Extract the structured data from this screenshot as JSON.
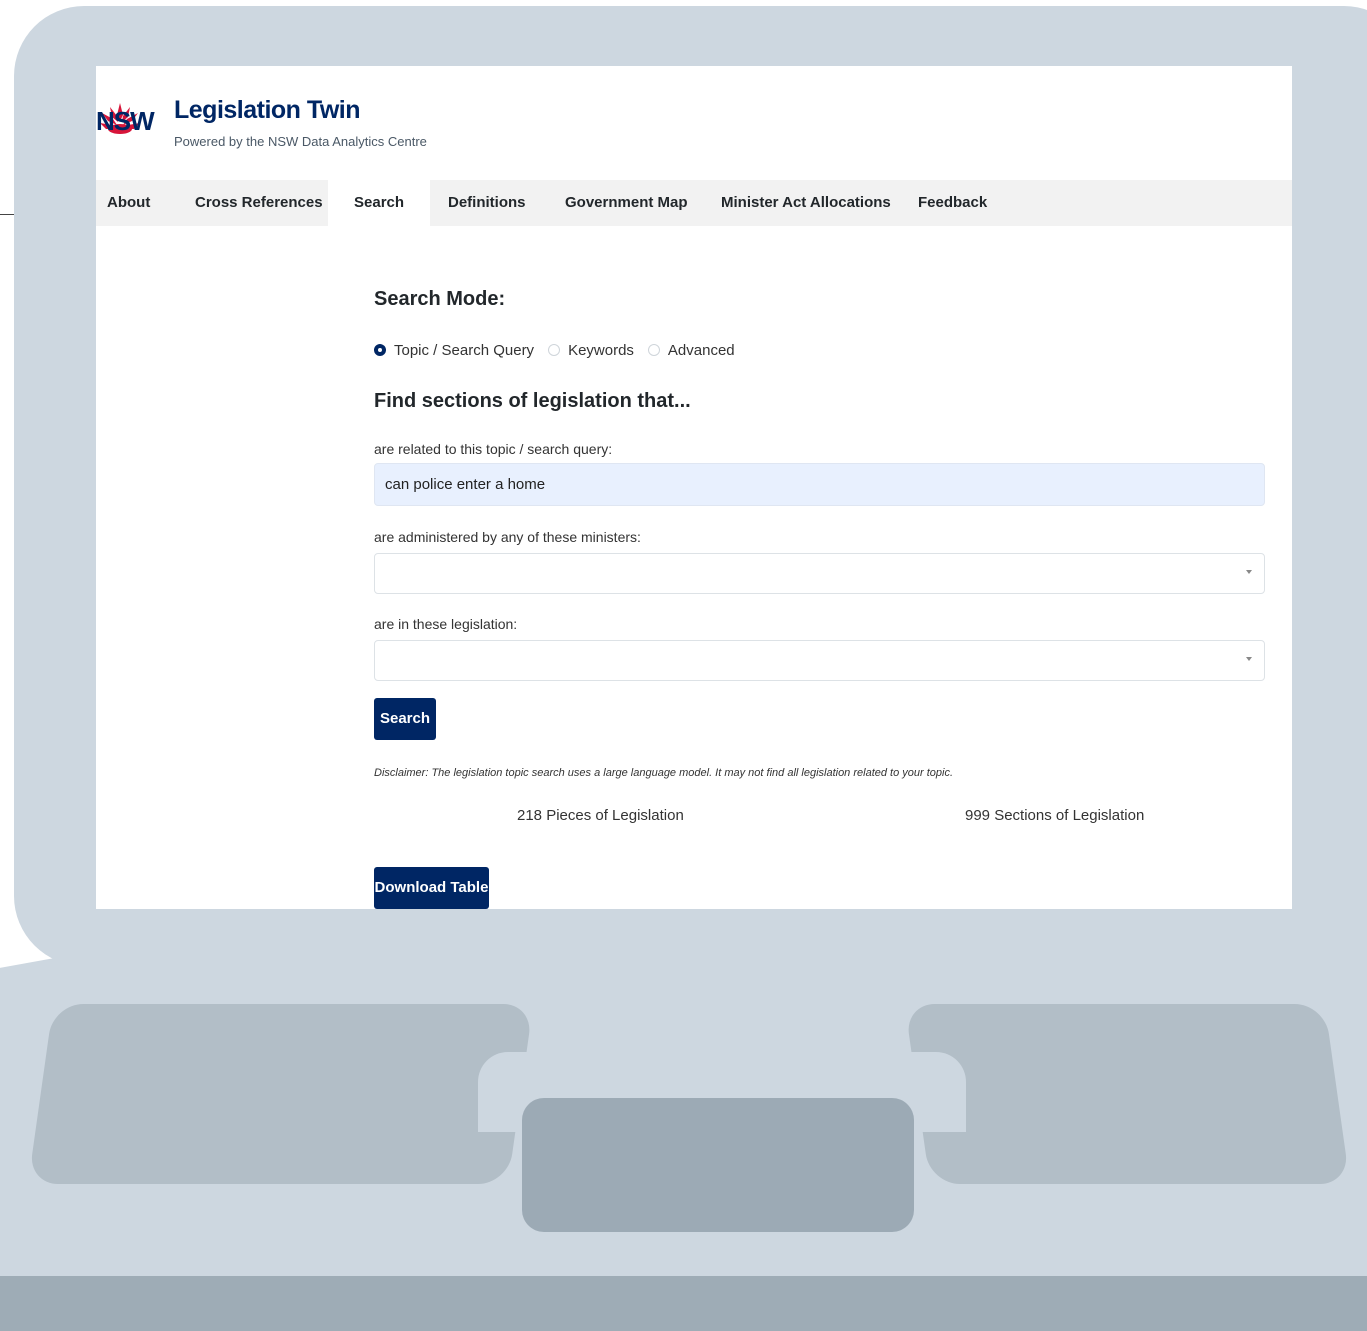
{
  "header": {
    "logo_text": "NSW",
    "title": "Legislation Twin",
    "subtitle": "Powered by the NSW Data Analytics Centre"
  },
  "nav": {
    "tabs": [
      {
        "label": "About"
      },
      {
        "label": "Cross References"
      },
      {
        "label": "Search",
        "active": true
      },
      {
        "label": "Definitions"
      },
      {
        "label": "Government Map"
      },
      {
        "label": "Minister Act Allocations"
      },
      {
        "label": "Feedback"
      }
    ]
  },
  "search": {
    "mode_heading": "Search Mode:",
    "modes": [
      {
        "label": "Topic / Search Query",
        "checked": true
      },
      {
        "label": "Keywords",
        "checked": false
      },
      {
        "label": "Advanced",
        "checked": false
      }
    ],
    "find_heading": "Find sections of legislation that...",
    "query_label": "are related to this topic / search query:",
    "query_value": "can police enter a home",
    "ministers_label": "are administered by any of these ministers:",
    "legislation_label": "are in these legislation:",
    "search_button": "Search",
    "disclaimer": "Disclaimer: The legislation topic search uses a large language model. It may not find all legislation related to your topic.",
    "pieces_count": "218 Pieces of Legislation",
    "sections_count": "999 Sections of Legislation",
    "download_button": "Download Table"
  },
  "colors": {
    "brand": "#002664",
    "logo_red": "#d7153a",
    "laptop_body": "#cdd7e0"
  }
}
